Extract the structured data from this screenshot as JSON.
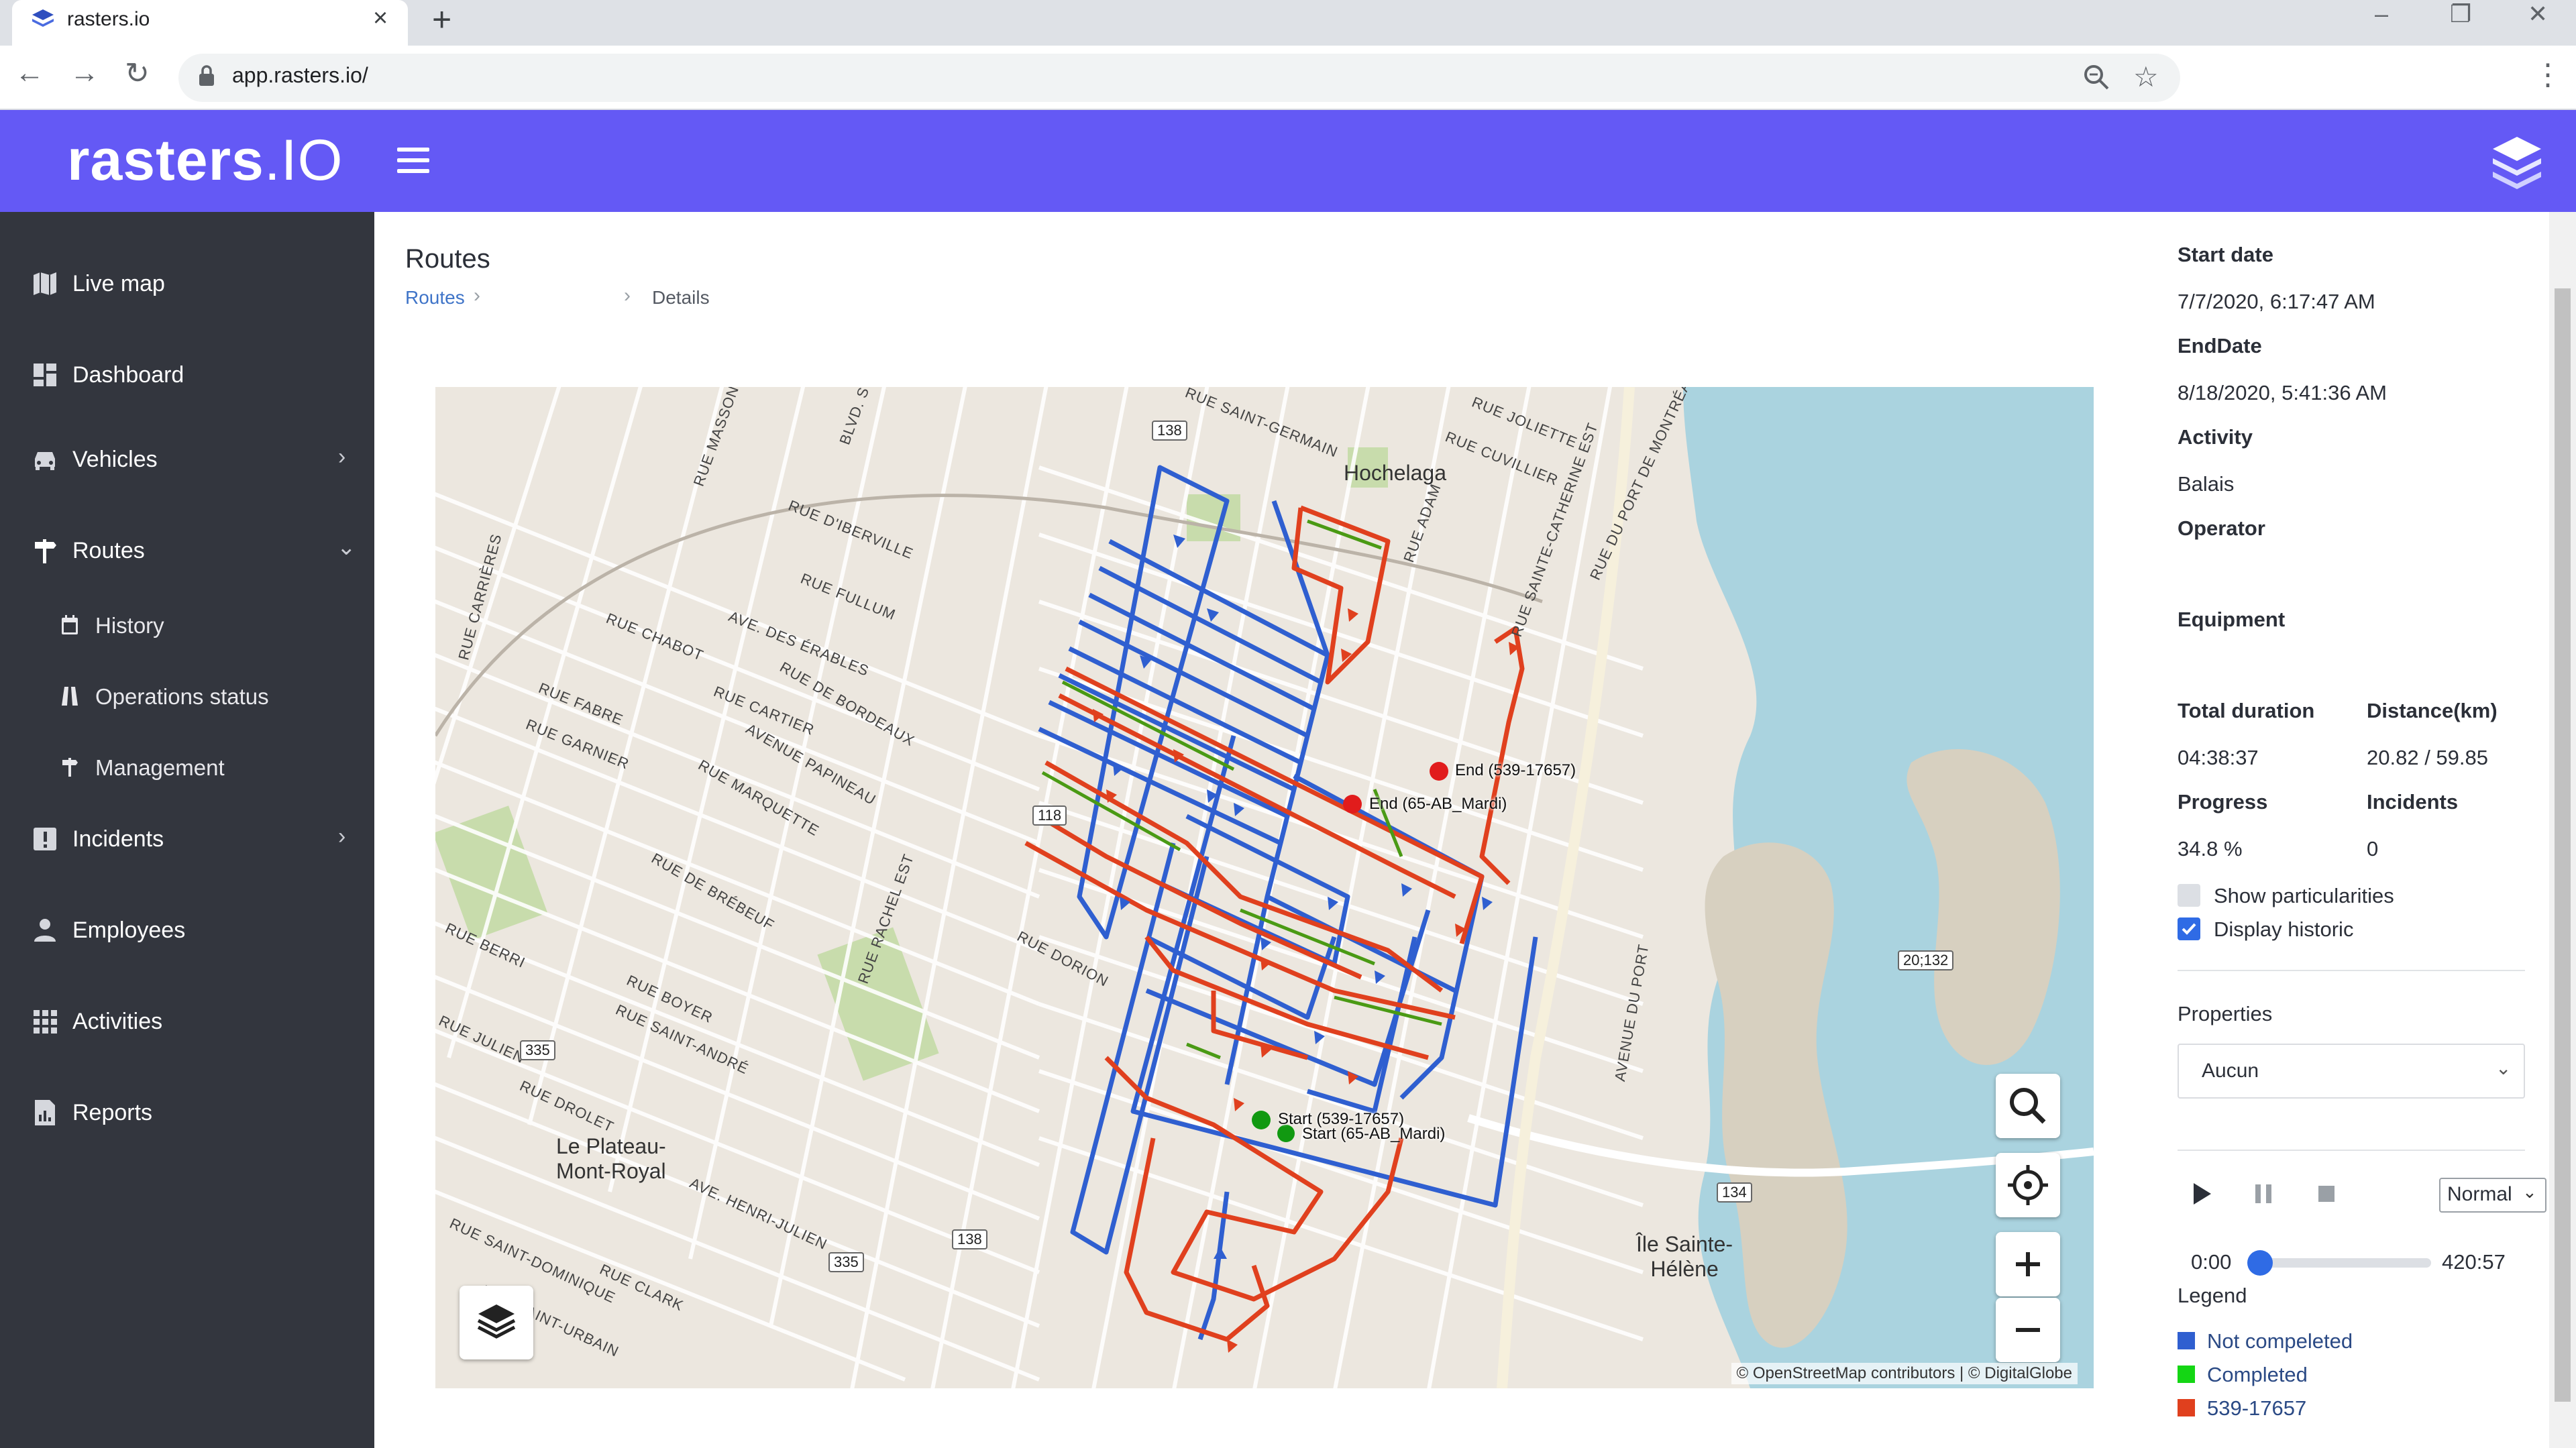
{
  "browser": {
    "tab_title": "rasters.io",
    "url": "app.rasters.io/"
  },
  "app": {
    "logo_main": "rasters",
    "logo_suffix": ".IO",
    "header_color": "#6459f5"
  },
  "sidebar": {
    "items": [
      {
        "label": "Live map",
        "icon": "map-icon"
      },
      {
        "label": "Dashboard",
        "icon": "dashboard-icon"
      },
      {
        "label": "Vehicles",
        "icon": "car-icon",
        "expandable": true
      },
      {
        "label": "Routes",
        "icon": "signpost-icon",
        "expanded": true
      },
      {
        "label": "History",
        "icon": "calendar-icon",
        "sub": true
      },
      {
        "label": "Operations status",
        "icon": "road-icon",
        "sub": true
      },
      {
        "label": "Management",
        "icon": "signpost-icon",
        "sub": true
      },
      {
        "label": "Incidents",
        "icon": "alert-icon",
        "expandable": true
      },
      {
        "label": "Employees",
        "icon": "person-icon"
      },
      {
        "label": "Activities",
        "icon": "grid-icon"
      },
      {
        "label": "Reports",
        "icon": "report-icon"
      }
    ]
  },
  "main": {
    "title": "Routes",
    "breadcrumb": {
      "root": "Routes",
      "current": "Details"
    }
  },
  "map": {
    "place_labels": [
      "Hochelaga",
      "Le Plateau-\nMont-Royal",
      "Île Sainte-\nHélène"
    ],
    "street_labels": [
      "RUE SAINT-GERMAIN",
      "RUE JOLIETTE",
      "RUE CUVILLIER",
      "RUE D'IBERVILLE",
      "RUE FULLUM",
      "RUE CHABOT",
      "AVE. DES ÉRABLES",
      "RUE FABRE",
      "RUE GARNIER",
      "RUE CARTIER",
      "RUE DE BORDEAUX",
      "AVENUE PAPINEAU",
      "RUE MARQUETTE",
      "RUE DE BRÉBEUF",
      "RUE BERRI",
      "RUE BOYER",
      "RUE SAINT-ANDRÉ",
      "RUE DROLET",
      "AVE. HENRI-JULIEN",
      "RUE SAINT-DOMINIQUE",
      "RUE CLARK",
      "RUE SAINT-URBAIN",
      "RUE DORION",
      "RUE RACHEL EST",
      "RUE SAINTE-CATHERINE EST",
      "RUE DU PORT DE MONTRÉAL",
      "RUE ADAM",
      "AVENUE DU PORT",
      "RUE MASSON",
      "RUE CARRIÈRES",
      "BLVD. S",
      "RUE JULIEN"
    ],
    "shields": [
      "138",
      "118",
      "335",
      "138",
      "335",
      "134",
      "20;132"
    ],
    "route_markers": [
      {
        "label": "End (539-17657)",
        "color": "#e11c1c"
      },
      {
        "label": "End (65-AB_Mardi)",
        "color": "#e11c1c"
      },
      {
        "label": "Start (539-17657)",
        "color": "#119911"
      },
      {
        "label": "Start (65-AB_Mardi)",
        "color": "#119911"
      }
    ],
    "attribution": "© OpenStreetMap contributors | © DigitalGlobe",
    "controls": [
      "zoom-search-icon",
      "locate-icon",
      "zoom-in-icon",
      "zoom-out-icon",
      "layers-icon"
    ]
  },
  "details": {
    "start_date_label": "Start date",
    "start_date": "7/7/2020, 6:17:47 AM",
    "end_date_label": "EndDate",
    "end_date": "8/18/2020, 5:41:36 AM",
    "activity_label": "Activity",
    "activity": "Balais",
    "operator_label": "Operator",
    "operator": "",
    "equipment_label": "Equipment",
    "equipment": "",
    "total_duration_label": "Total duration",
    "total_duration": "04:38:37",
    "distance_label": "Distance(km)",
    "distance": "20.82 / 59.85",
    "progress_label": "Progress",
    "progress": "34.8 %",
    "incidents_label": "Incidents",
    "incidents": "0",
    "show_particularities": {
      "label": "Show particularities",
      "checked": false
    },
    "display_historic": {
      "label": "Display historic",
      "checked": true
    },
    "properties_label": "Properties",
    "properties_value": "Aucun"
  },
  "playback": {
    "speed": "Normal",
    "time_start": "0:00",
    "time_end": "420:57",
    "position_fraction": 0.0
  },
  "legend": {
    "title": "Legend",
    "items": [
      {
        "label": "Not compeleted",
        "color": "#2f5fd0"
      },
      {
        "label": "Completed",
        "color": "#14d614"
      },
      {
        "label": "539-17657",
        "color": "#e0401e"
      }
    ]
  }
}
